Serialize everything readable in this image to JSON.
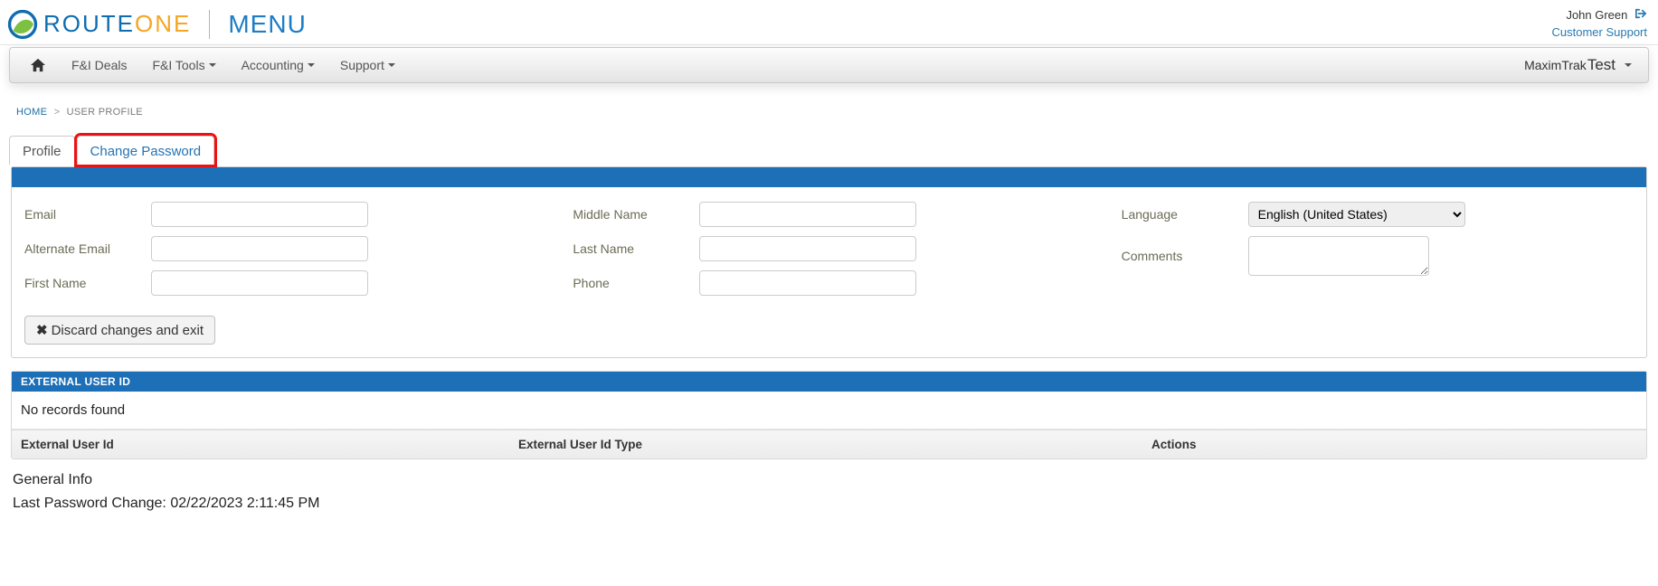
{
  "brand": {
    "name_primary": "ROUTE",
    "name_secondary": "ONE",
    "menu_label": "MENU"
  },
  "user": {
    "name": "John Green",
    "support_label": "Customer Support"
  },
  "nav": {
    "items": [
      {
        "label": "F&I Deals",
        "caret": false
      },
      {
        "label": "F&I Tools",
        "caret": true
      },
      {
        "label": "Accounting",
        "caret": true
      },
      {
        "label": "Support",
        "caret": true
      }
    ],
    "dealer": {
      "prefix": "MaximTrak",
      "suffix": "Test"
    }
  },
  "breadcrumb": {
    "home": "HOME",
    "current": "USER PROFILE"
  },
  "tabs": {
    "profile": "Profile",
    "change_password": "Change Password"
  },
  "form": {
    "email_label": "Email",
    "alt_email_label": "Alternate Email",
    "first_name_label": "First Name",
    "middle_name_label": "Middle Name",
    "last_name_label": "Last Name",
    "phone_label": "Phone",
    "language_label": "Language",
    "comments_label": "Comments",
    "language_value": "English (United States)",
    "discard_label": "Discard changes and exit"
  },
  "external": {
    "title": "EXTERNAL USER ID",
    "empty": "No records found",
    "col1": "External User Id",
    "col2": "External User Id Type",
    "col3": "Actions"
  },
  "general_info": {
    "title": "General Info",
    "last_pw_change_label": "Last Password Change:",
    "last_pw_change_value": "02/22/2023 2:11:45 PM"
  }
}
